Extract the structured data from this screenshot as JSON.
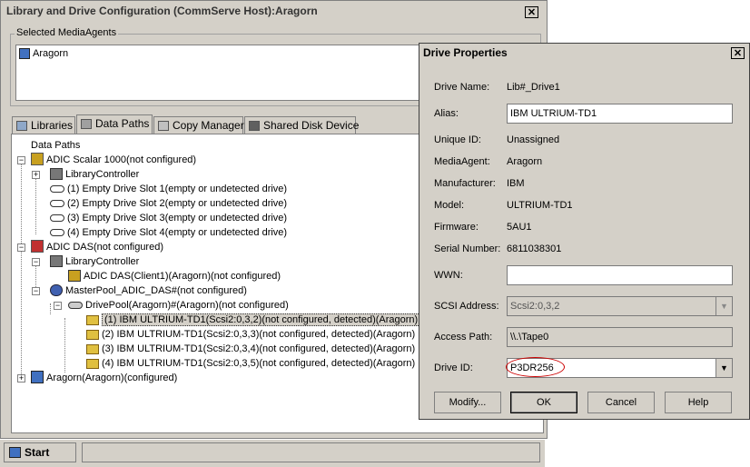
{
  "main_window": {
    "title": "Library and Drive Configuration (CommServe Host):Aragorn",
    "close_glyph": "✕",
    "selected_mediaagents_label": "Selected MediaAgents",
    "mediaagents": [
      "Aragorn"
    ]
  },
  "tabs": [
    {
      "label": "Libraries",
      "icon": "library-icon"
    },
    {
      "label": "Data Paths",
      "icon": "data-paths-icon"
    },
    {
      "label": "Copy Manager",
      "icon": "copy-manager-icon"
    },
    {
      "label": "Shared Disk Device",
      "icon": "shared-disk-icon"
    }
  ],
  "tree": {
    "root_label": "Data Paths",
    "nodes": [
      "ADIC Scalar 1000(not configured)",
      "LibraryController",
      "(1) Empty Drive Slot 1(empty or undetected drive)",
      "(2) Empty Drive Slot 2(empty or undetected drive)",
      "(3) Empty Drive Slot 3(empty or undetected drive)",
      "(4) Empty Drive Slot 4(empty or undetected drive)",
      "ADIC DAS(not configured)",
      "LibraryController",
      "ADIC DAS(Client1)(Aragorn)(not configured)",
      "MasterPool_ADIC_DAS#(not configured)",
      "DrivePool(Aragorn)#(Aragorn)(not configured)",
      "(1) IBM ULTRIUM-TD1(Scsi2:0,3,2)(not configured, detected)(Aragorn)",
      "(2) IBM ULTRIUM-TD1(Scsi2:0,3,3)(not configured, detected)(Aragorn)",
      "(3) IBM ULTRIUM-TD1(Scsi2:0,3,4)(not configured, detected)(Aragorn)",
      "(4) IBM ULTRIUM-TD1(Scsi2:0,3,5)(not configured, detected)(Aragorn)",
      "Aragorn(Aragorn)(configured)"
    ]
  },
  "dialog": {
    "title": "Drive Properties",
    "close_glyph": "✕",
    "drive_name_label": "Drive Name:",
    "drive_name": "Lib#_Drive1",
    "alias_label": "Alias:",
    "alias": "IBM ULTRIUM-TD1",
    "unique_id_label": "Unique ID:",
    "unique_id": "Unassigned",
    "mediaagent_label": "MediaAgent:",
    "mediaagent": "Aragorn",
    "manufacturer_label": "Manufacturer:",
    "manufacturer": "IBM",
    "model_label": "Model:",
    "model": "ULTRIUM-TD1",
    "firmware_label": "Firmware:",
    "firmware": "5AU1",
    "serial_label": "Serial Number:",
    "serial": "6811038301",
    "wwn_label": "WWN:",
    "wwn": "",
    "scsi_label": "SCSI Address:",
    "scsi": "Scsi2:0,3,2",
    "access_path_label": "Access Path:",
    "access_path": "\\\\.\\Tape0",
    "drive_id_label": "Drive ID:",
    "drive_id": "P3DR256",
    "buttons": {
      "modify": "Modify...",
      "ok": "OK",
      "cancel": "Cancel",
      "help": "Help"
    },
    "highlight_color": "#cc0000"
  },
  "taskbar": {
    "start_label": "Start"
  }
}
